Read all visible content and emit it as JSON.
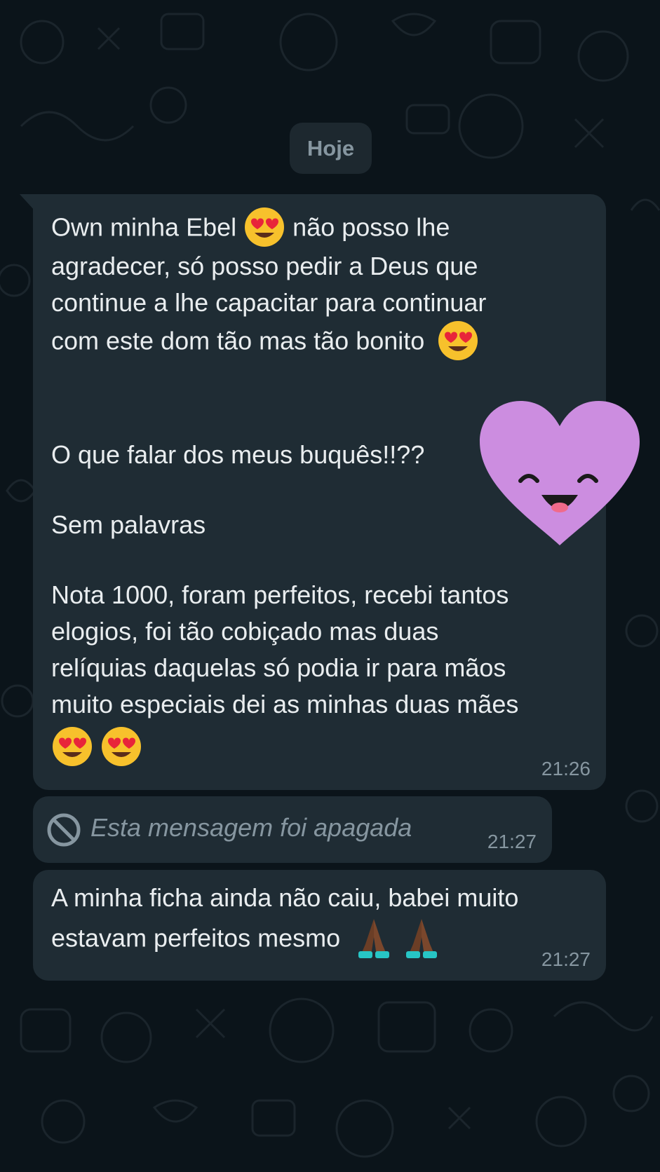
{
  "date_divider": "Hoje",
  "message_1": {
    "lines": [
      "Own minha Ebel",
      "não posso lhe",
      "agradecer, só posso pedir a Deus que",
      "continue a lhe capacitar para continuar",
      "com este dom tão mas tão bonito",
      "O que falar dos meus buquês!!??",
      "Sem palavras",
      "Nota 1000, foram perfeitos, recebi tantos",
      "elogios, foi tão cobiçado mas duas",
      "relíquias daquelas só podia ir para mãos",
      "muito especiais dei as minhas duas mães"
    ],
    "time": "21:26"
  },
  "message_2": {
    "text": "Esta mensagem foi apagada",
    "time": "21:27"
  },
  "message_3": {
    "lines": [
      "A minha ficha ainda não caiu, babei muito",
      "estavam perfeitos mesmo"
    ],
    "time": "21:27"
  },
  "colors": {
    "background": "#0b141a",
    "bubble": "#1f2c34",
    "text": "#e9edef",
    "meta": "#8696a0",
    "heart": "#cc8de0"
  },
  "icons": {
    "heart_eyes": "heart-eyes-emoji",
    "folded_hands": "folded-hands-emoji",
    "deleted": "block-icon",
    "sticker": "smiling-heart-sticker"
  }
}
